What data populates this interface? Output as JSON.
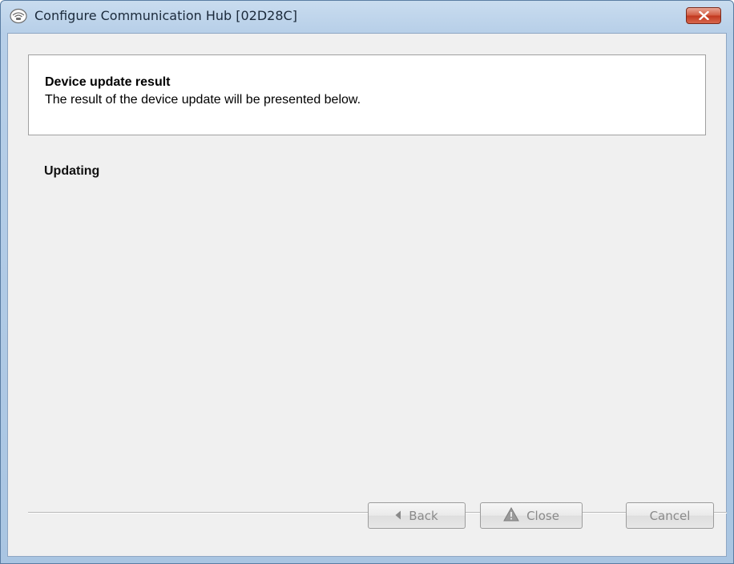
{
  "window": {
    "title": "Configure Communication Hub [02D28C]",
    "app_icon": "hub-icon",
    "close_icon": "close-icon"
  },
  "header": {
    "title": "Device update result",
    "description": "The result of the device update will be presented below."
  },
  "status": {
    "text": "Updating"
  },
  "buttons": {
    "back": {
      "label": "Back",
      "icon": "arrow-left-icon",
      "enabled": false
    },
    "close": {
      "label": "Close",
      "icon": "warning-triangle-icon",
      "enabled": false
    },
    "cancel": {
      "label": "Cancel",
      "enabled": false
    }
  },
  "colors": {
    "titlebar": "#b7cfe8",
    "client_background": "#f0f0f0",
    "close_button": "#c1371e",
    "disabled_text": "#8a8a8a"
  }
}
